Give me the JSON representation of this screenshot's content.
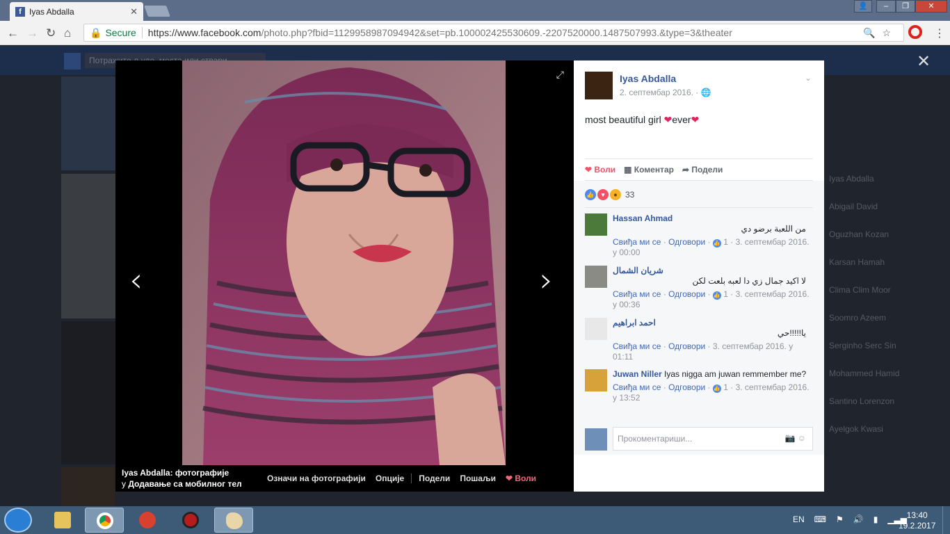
{
  "browser": {
    "tab_title": "Iyas Abdalla",
    "tab_favicon": "f",
    "secure_label": "Secure",
    "url_host": "https://www.facebook.com",
    "url_path": "/photo.php?fbid=1129958987094942&set=pb.100002425530609.-2207520000.1487507993.&type=3&theater"
  },
  "facebook": {
    "search_placeholder": "Потражите људе, места или ствари",
    "chat_contacts": [
      "Iyas Abdalla",
      "Abigail David",
      "Oguzhan Kozan",
      "Karsan Hamah",
      "Clima Clim Moor",
      "Soomro Azeem",
      "Serginho Serc Sin",
      "Mohammed Hamid",
      "Santino Lorenzon",
      "Ayelgok Kwasi"
    ]
  },
  "theater": {
    "caption_title": "Iyas Abdalla: фотографије",
    "caption_prefix": "у",
    "caption_album": "Додавање са мобилног тел",
    "actions": {
      "tag": "Означи на фотографији",
      "options": "Опције",
      "share": "Подели",
      "send": "Пошаљи",
      "like": "Воли"
    }
  },
  "post": {
    "author": "Iyas Abdalla",
    "date": "2. септембар 2016. ·",
    "text_a": "most beautiful girl ",
    "text_b": "ever",
    "heart": "❤",
    "action_like": "Воли",
    "action_comment": "Коментар",
    "action_share": "Подели",
    "reaction_count": "33"
  },
  "comments": [
    {
      "name": "Hassan Ahmad",
      "text": "من اللعبة برضو دي",
      "like": "Свиђа ми се",
      "reply": "Одговори",
      "count": "1",
      "time": "3. септембар 2016. у 00:00"
    },
    {
      "name": "شريان الشمال",
      "text": "لا اكيد جمال زي دا لعبه بلعت لكن",
      "like": "Свиђа ми се",
      "reply": "Одговори",
      "count": "1",
      "time": "3. септембар 2016. у 00:36"
    },
    {
      "name": "احمد ابراهيم",
      "text": "يا!!!!!حي",
      "like": "Свиђа ми се",
      "reply": "Одговори",
      "count": "",
      "time": "3. септембар 2016. у 01:11"
    },
    {
      "name": "Juwan Niller",
      "text": "Iyas nigga am juwan remmember me?",
      "like": "Свиђа ми се",
      "reply": "Одговори",
      "count": "1",
      "time": "3. септембар 2016. у 13:52"
    }
  ],
  "write_comment": {
    "placeholder": "Прокоментариши..."
  },
  "taskbar": {
    "lang": "EN",
    "time": "13:40",
    "date": "19.2.2017"
  }
}
